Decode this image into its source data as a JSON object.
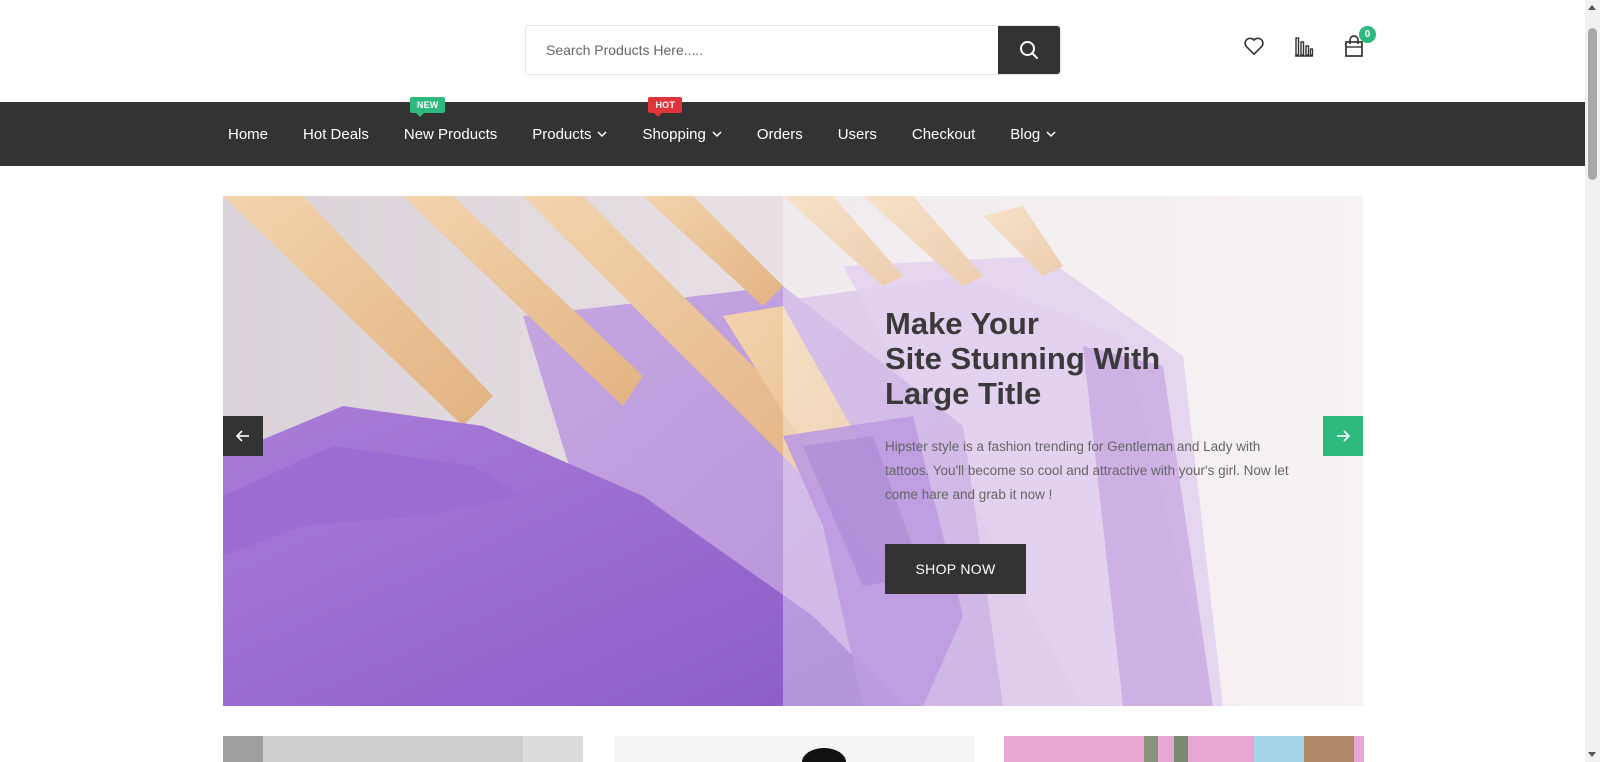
{
  "header": {
    "search_placeholder": "Search Products Here.....",
    "icons": [
      "heart-icon",
      "compare-icon",
      "cart-icon"
    ],
    "cart_count": "0"
  },
  "nav": {
    "items": [
      {
        "label": "Home"
      },
      {
        "label": "Hot Deals"
      },
      {
        "label": "New Products",
        "tag": "NEW"
      },
      {
        "label": "Products",
        "dropdown": true
      },
      {
        "label": "Shopping",
        "dropdown": true,
        "tag": "HOT"
      },
      {
        "label": "Orders"
      },
      {
        "label": "Users"
      },
      {
        "label": "Checkout"
      },
      {
        "label": "Blog",
        "dropdown": true
      }
    ]
  },
  "hero": {
    "title_line1": "Make Your",
    "title_line2": "Site Stunning With",
    "title_line3": "Large Title",
    "description": "Hipster style is a fashion trending for Gentleman and Lady with tattoos. You'll become so cool and attractive with your's girl. Now let come hare and grab it now !",
    "button_label": "SHOP NOW"
  },
  "colors": {
    "dark": "#333333",
    "accent_green": "#2eb97e",
    "hot_red": "#e0343d"
  }
}
